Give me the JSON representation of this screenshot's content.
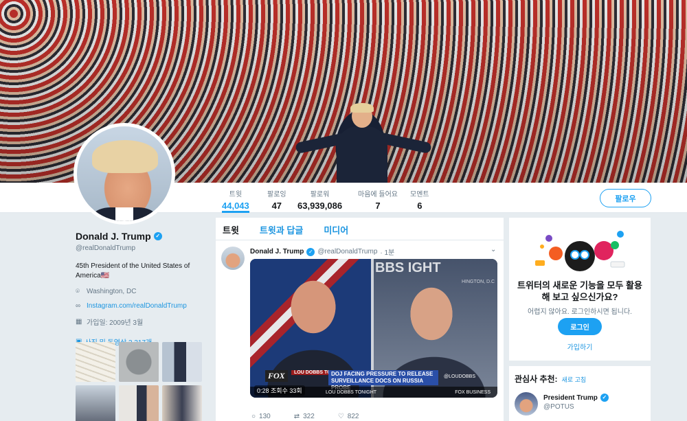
{
  "nav": {
    "stats": [
      {
        "label": "트윗",
        "value": "44,043"
      },
      {
        "label": "팔로잉",
        "value": "47"
      },
      {
        "label": "팔로워",
        "value": "63,939,086"
      },
      {
        "label": "마음에 들어요",
        "value": "7"
      },
      {
        "label": "모멘트",
        "value": "6"
      }
    ],
    "follow_label": "팔로우"
  },
  "profile": {
    "name": "Donald J. Trump",
    "handle": "@realDonaldTrump",
    "bio": "45th President of the United States of America🇺🇸",
    "location": "Washington, DC",
    "website": "Instagram.com/realDonaldTrump",
    "joined": "가입일: 2009년 3월",
    "media_link": "사진 및 동영상 3,317개"
  },
  "timeline": {
    "tabs": [
      "트윗",
      "트윗과 답글",
      "미디어"
    ],
    "tweet": {
      "name": "Donald J. Trump",
      "handle": "@realDonaldTrump",
      "time": "· 1분",
      "video": {
        "brand": "FOX",
        "show": "LOU DOBBS TONIGHT",
        "headline": "DOJ FACING PRESSURE TO RELEASE SURVEILLANCE DOCS ON RUSSIA PROBE",
        "handle_tag": "@LOUDOBBS",
        "bottom_left": "LOU DOBBS TONIGHT",
        "bottom_right": "FOX BUSINESS",
        "bg_text": "BBS IGHT",
        "bg_location": "HINGTON, D.C",
        "overlay": "0:28  조회수 33회"
      },
      "actions": {
        "replies": "130",
        "retweets": "322",
        "likes": "822"
      }
    }
  },
  "signup": {
    "title": "트위터의 새로운 기능을 모두 활용해 보고 싶으신가요?",
    "sub": "어렵지 않아요. 로그인하시면 됩니다.",
    "login": "로그인",
    "signup": "가입하기"
  },
  "who_to_follow": {
    "title": "관심사 추천:",
    "refresh": "새로 고침",
    "user": {
      "name": "President Trump",
      "handle": "@POTUS"
    }
  },
  "colors": {
    "accent": "#1da1f2",
    "link": "#1b95e0",
    "muted": "#657786",
    "bg": "#e6ecf0"
  }
}
